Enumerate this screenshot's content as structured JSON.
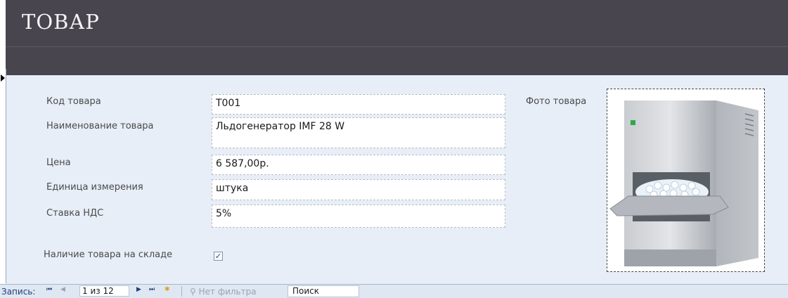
{
  "header": {
    "title": "ТОВАР"
  },
  "fields": {
    "code_label": "Код товара",
    "code_value": "T001",
    "name_label": "Наименование товара",
    "name_value": "Льдогенератор IMF 28 W",
    "price_label": "Цена",
    "price_value": "6 587,00р.",
    "unit_label": "Единица измерения",
    "unit_value": "штука",
    "vat_label": "Ставка НДС",
    "vat_value": "5%",
    "stock_label": "Наличие товара на складе",
    "stock_checked": true,
    "stock_mark": "✓",
    "photo_label": "Фото товара"
  },
  "navigation": {
    "record_label": "Запись:",
    "first_icon": "⏮",
    "prev_icon": "◀",
    "position": "1 из 12",
    "next_icon": "▶",
    "last_icon": "⏭",
    "new_icon": "✱",
    "filter_label": "Нет фильтра",
    "search_label": "Поиск"
  },
  "colors": {
    "header_bg": "#48454f",
    "form_bg": "#e8eef7",
    "navbar_bg": "#dfe7f2",
    "accent": "#1f3f7a"
  }
}
